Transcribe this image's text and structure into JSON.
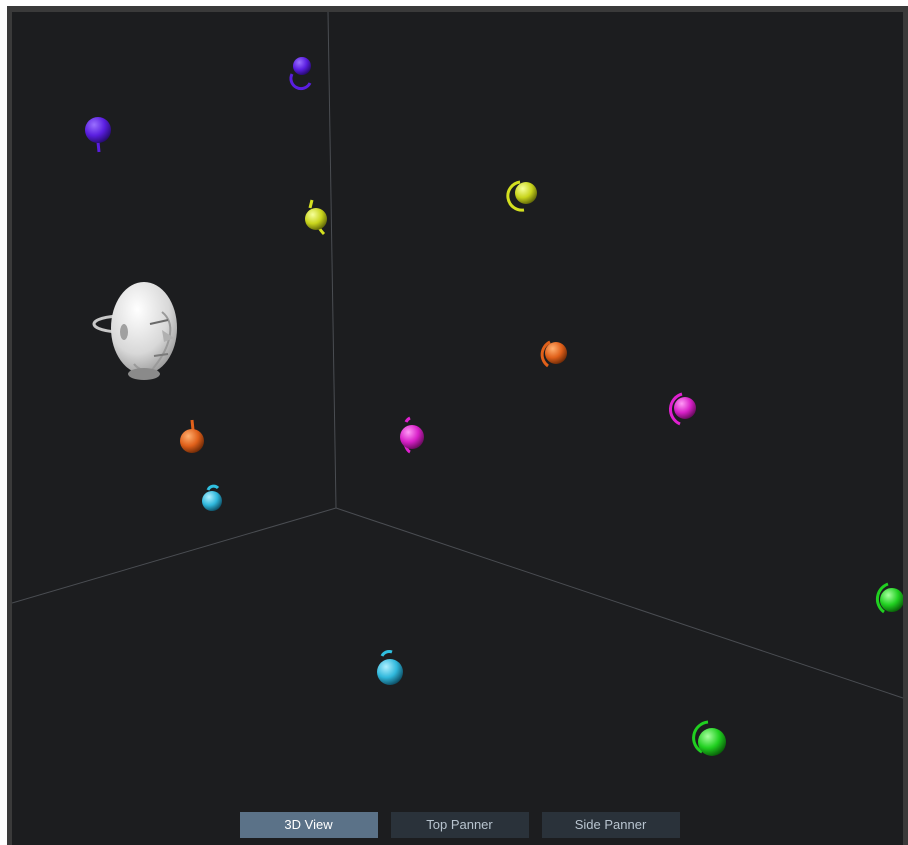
{
  "tabs": [
    {
      "label": "3D View",
      "active": true
    },
    {
      "label": "Top Panner",
      "active": false
    },
    {
      "label": "Side Panner",
      "active": false
    }
  ],
  "listener": {
    "icon": "listener-head-icon"
  },
  "colors": {
    "background": "#1c1d1f",
    "frame": "#3a3a3a",
    "grid_line": "#4a4d52",
    "tab_active": "#5b7288",
    "tab_inactive": "#2a323a",
    "purple": "#5a1ee0",
    "yellow": "#d4e020",
    "orange": "#e0601a",
    "magenta": "#e020d0",
    "cyan": "#30c0e0",
    "green": "#20d020"
  },
  "sources": [
    {
      "name": "source-purple-1",
      "color": "purple"
    },
    {
      "name": "source-purple-2",
      "color": "purple"
    },
    {
      "name": "source-yellow-1",
      "color": "yellow"
    },
    {
      "name": "source-yellow-2",
      "color": "yellow"
    },
    {
      "name": "source-orange-1",
      "color": "orange"
    },
    {
      "name": "source-orange-2",
      "color": "orange"
    },
    {
      "name": "source-magenta-1",
      "color": "magenta"
    },
    {
      "name": "source-magenta-2",
      "color": "magenta"
    },
    {
      "name": "source-cyan-1",
      "color": "cyan"
    },
    {
      "name": "source-cyan-2",
      "color": "cyan"
    },
    {
      "name": "source-green-1",
      "color": "green"
    },
    {
      "name": "source-green-2",
      "color": "green"
    }
  ]
}
